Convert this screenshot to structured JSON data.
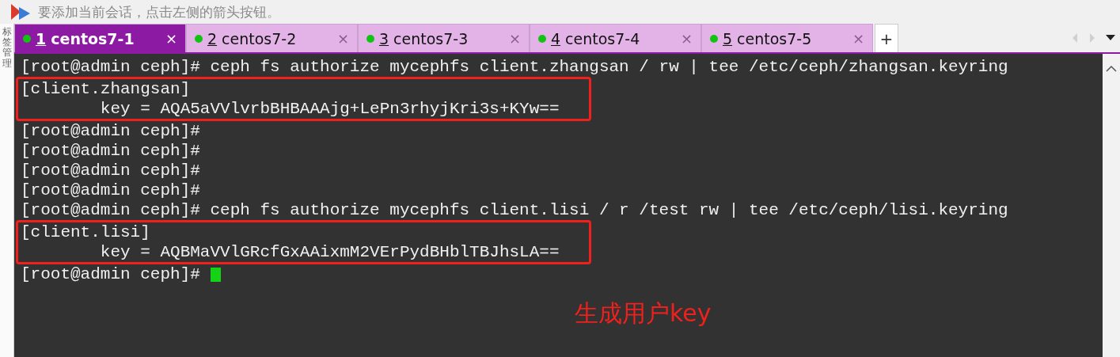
{
  "hint_bar": {
    "text": "要添加当前会话，点击左侧的箭头按钮。"
  },
  "side_tab": {
    "label": "标签管理"
  },
  "tabs": [
    {
      "number": "1",
      "label": "centos7-1",
      "selected": true,
      "connected": true,
      "close": "×"
    },
    {
      "number": "2",
      "label": "centos7-2",
      "selected": false,
      "connected": true,
      "close": "×"
    },
    {
      "number": "3",
      "label": "centos7-3",
      "selected": false,
      "connected": true,
      "close": "×"
    },
    {
      "number": "4",
      "label": "centos7-4",
      "selected": false,
      "connected": true,
      "close": "×"
    },
    {
      "number": "5",
      "label": "centos7-5",
      "selected": false,
      "connected": true,
      "close": "×"
    }
  ],
  "new_tab": "+",
  "terminal": {
    "lines": [
      {
        "text": "[root@admin ceph]# ceph fs authorize mycephfs client.zhangsan / rw | tee /etc/ceph/zhangsan.keyring",
        "highlighted": false
      },
      {
        "text": "[client.zhangsan]",
        "highlighted": true
      },
      {
        "text": "        key = AQA5aVVlvrbBHBAAAjg+LePn3rhyjKri3s+KYw==",
        "highlighted": true
      },
      {
        "text": "[root@admin ceph]#",
        "highlighted": false
      },
      {
        "text": "[root@admin ceph]#",
        "highlighted": false
      },
      {
        "text": "[root@admin ceph]#",
        "highlighted": false
      },
      {
        "text": "[root@admin ceph]#",
        "highlighted": false
      },
      {
        "text": "[root@admin ceph]# ceph fs authorize mycephfs client.lisi / r /test rw | tee /etc/ceph/lisi.keyring",
        "highlighted": false
      },
      {
        "text": "[client.lisi]",
        "highlighted": true
      },
      {
        "text": "        key = AQBMaVVlGRcfGxAAixmM2VErPydBHblTBJhsLA==",
        "highlighted": true
      },
      {
        "text": "[root@admin ceph]#",
        "highlighted": false
      }
    ],
    "cursor": true,
    "annotation": "生成用户key"
  }
}
